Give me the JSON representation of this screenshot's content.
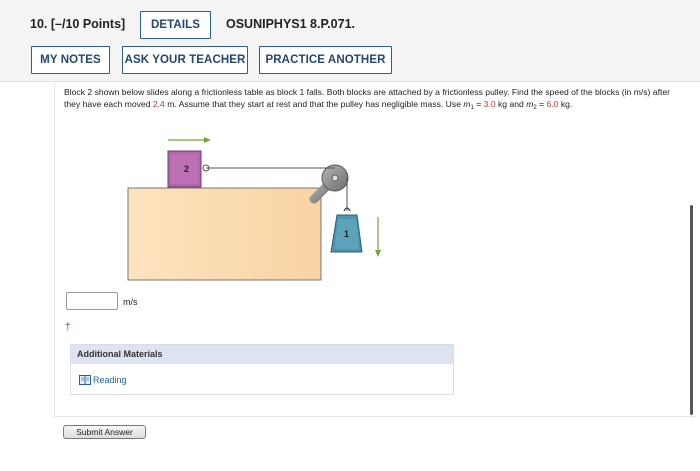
{
  "header": {
    "question_number": "10.",
    "points": "[–/10 Points]",
    "details_label": "DETAILS",
    "code": "OSUNIPHYS1 8.P.071.",
    "my_notes_label": "MY NOTES",
    "ask_teacher_label": "ASK YOUR TEACHER",
    "practice_label": "PRACTICE ANOTHER"
  },
  "problem": {
    "t1": "Block 2 shown below slides along a frictionless table as block 1 falls. Both blocks are attached by a frictionless pulley. Find the speed of the blocks (in m/s) after they have each moved ",
    "distance": "2.4",
    "t2": " m. Assume that they start at rest and that the pulley has negligible mass. Use ",
    "m1_sym": "m",
    "m1_sub": "1",
    "eq1": " = ",
    "m1_val": "3.0",
    "t3": " kg and ",
    "m2_sym": "m",
    "m2_sub": "2",
    "eq2": " = ",
    "m2_val": "6.0",
    "t4": " kg."
  },
  "figure": {
    "block2_label": "2",
    "block1_label": "1",
    "colors": {
      "table": "#fbdcb3",
      "block2": "#b267ab",
      "block1": "#4c95ad",
      "arrow": "#6ea635",
      "pulley": "#888888"
    }
  },
  "answer": {
    "value": "",
    "unit": "m/s",
    "dagger": "†"
  },
  "additional": {
    "title": "Additional Materials",
    "reading_label": "Reading",
    "reading_icon": "book-icon"
  },
  "submit_label": "Submit Answer"
}
